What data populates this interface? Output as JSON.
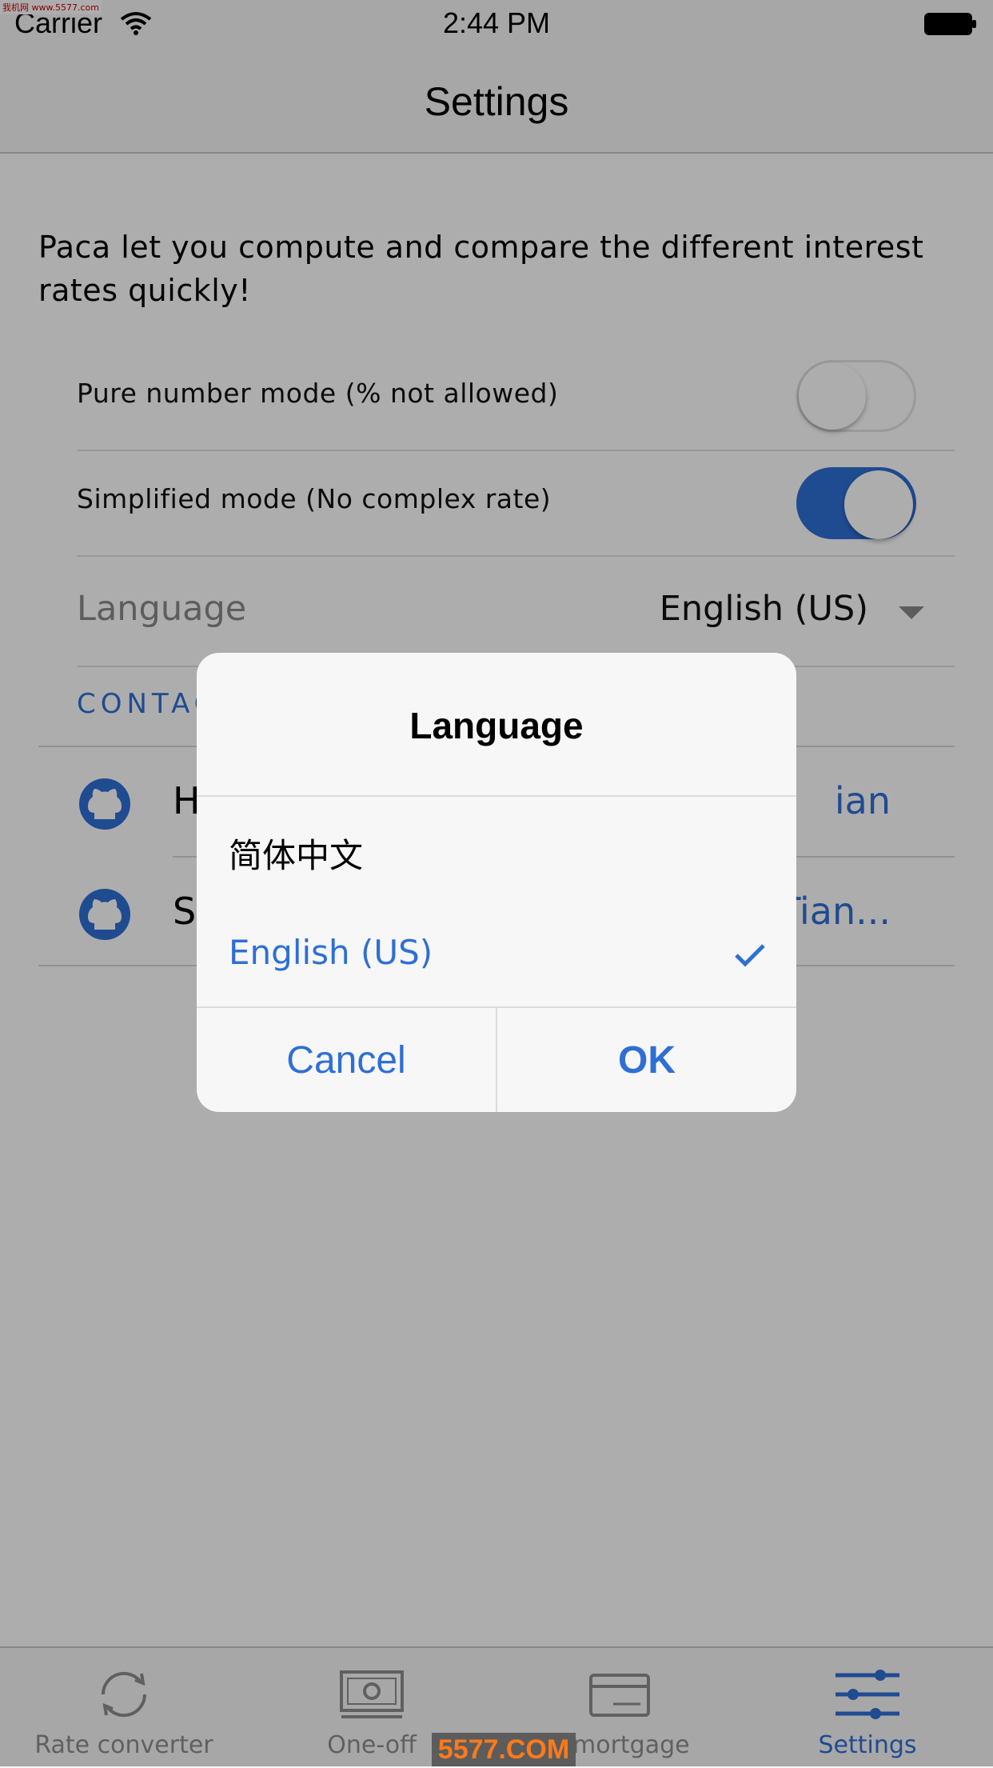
{
  "status_bar": {
    "carrier": "Carrier",
    "time": "2:44 PM",
    "watermark": "我机网 www.5577.com"
  },
  "nav": {
    "title": "Settings"
  },
  "intro": "Paca let you compute and compare the different interest rates quickly!",
  "settings": {
    "pure_number_label": "Pure number mode (% not allowed)",
    "pure_number_enabled": false,
    "simplified_label": "Simplified mode (No complex rate)",
    "simplified_enabled": true,
    "language_label": "Language",
    "language_value": "English (US)"
  },
  "contact": {
    "header": "CONTACT",
    "rows": [
      {
        "text": "H",
        "link": "ian",
        "icon": "github-icon"
      },
      {
        "text": "S",
        "link": "Tian...",
        "icon": "github-icon"
      }
    ]
  },
  "tabs": [
    {
      "label": "Rate converter",
      "icon": "refresh-icon",
      "active": false
    },
    {
      "label": "One-off",
      "icon": "banknote-icon",
      "active": false
    },
    {
      "label": "d mortgage",
      "icon": "card-icon",
      "active": false
    },
    {
      "label": "Settings",
      "icon": "sliders-icon",
      "active": true
    }
  ],
  "dialog": {
    "title": "Language",
    "options": [
      {
        "label": "简体中文",
        "selected": false
      },
      {
        "label": "English (US)",
        "selected": true
      }
    ],
    "cancel_label": "Cancel",
    "ok_label": "OK"
  },
  "colors": {
    "accent": "#2e6fd6",
    "overlay": "rgba(0,0,0,0.32)"
  },
  "watermark_bottom": "5577.COM"
}
